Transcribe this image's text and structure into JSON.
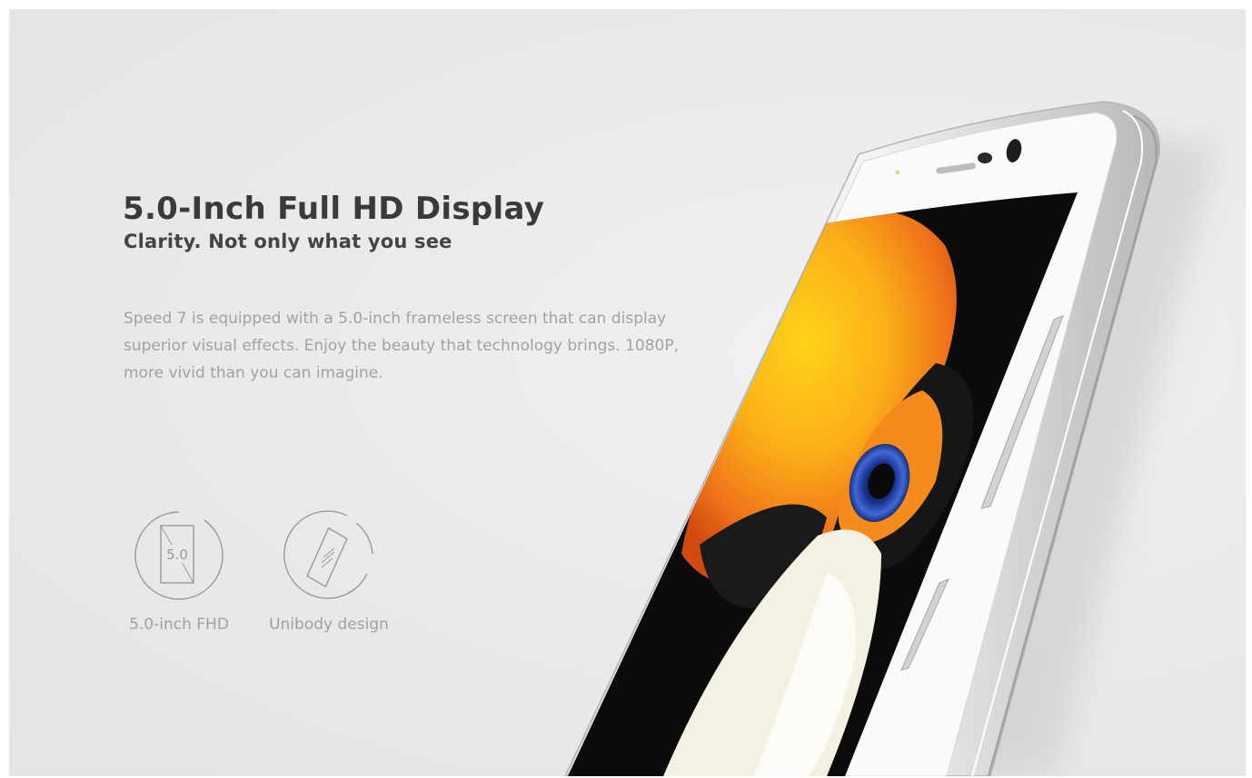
{
  "hero": {
    "headline": "5.0-Inch Full HD Display",
    "subheadline": "Clarity. Not only what you see",
    "description": "Speed 7 is equipped with a 5.0-inch frameless screen that can display superior visual effects. Enjoy the beauty that technology brings. 1080P, more vivid than you can imagine."
  },
  "features": [
    {
      "icon": "screen-size-icon",
      "icon_text": "5.0",
      "label": "5.0-inch FHD"
    },
    {
      "icon": "unibody-icon",
      "label": "Unibody design"
    }
  ],
  "colors": {
    "background": "#e9e9e9",
    "headline": "#3a3a3a",
    "body_text": "#a2a2a2",
    "icon_stroke": "#9a9a9a",
    "phone_frame": "#c8c8c8",
    "toucan_beak": "#f39a1a",
    "toucan_eye": "#2c4fb0"
  }
}
